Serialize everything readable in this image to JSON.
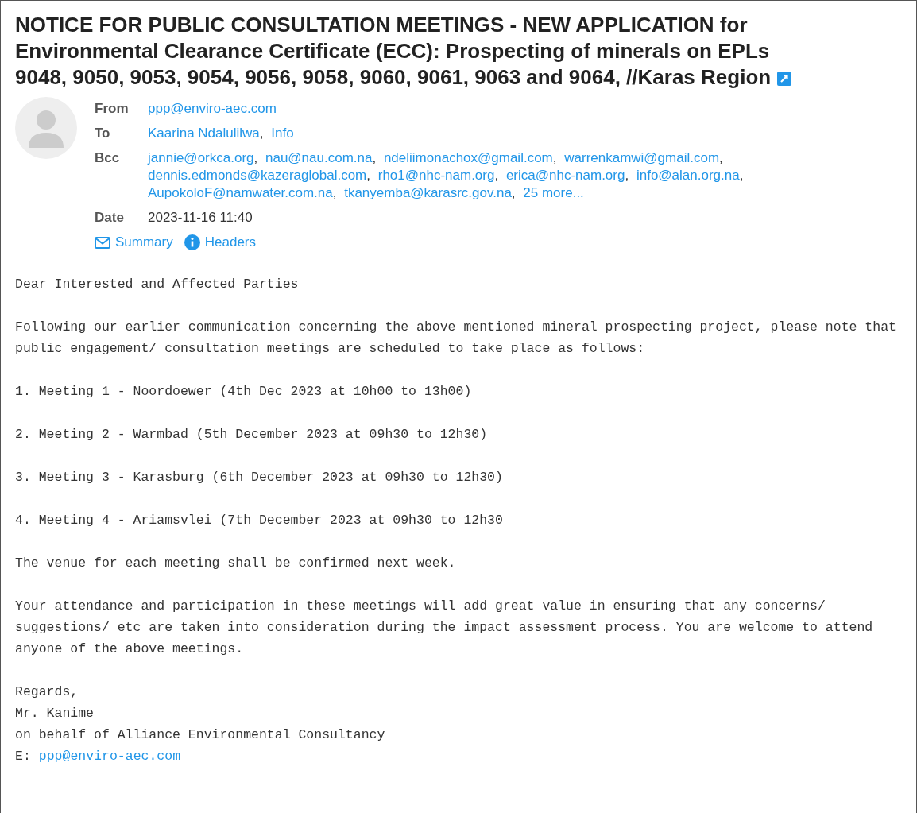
{
  "subject": {
    "text": "NOTICE FOR PUBLIC CONSULTATION MEETINGS - NEW APPLICATION for Environmental Clearance Certificate (ECC): Prospecting of minerals on EPLs 9048, 9050, 9053, 9054, 9056, 9058, 9060, 9061, 9063 and 9064, //Karas Region"
  },
  "header": {
    "separator": ",",
    "fields": [
      {
        "kind": "links",
        "label": "From",
        "values": [
          "ppp@enviro-aec.com"
        ]
      },
      {
        "kind": "links",
        "label": "To",
        "values": [
          "Kaarina Ndalulilwa",
          "Info"
        ]
      },
      {
        "kind": "links",
        "label": "Bcc",
        "values": [
          "jannie@orkca.org",
          "nau@nau.com.na",
          "ndeliimonachox@gmail.com",
          "warrenkamwi@gmail.com",
          "dennis.edmonds@kazeraglobal.com",
          "rho1@nhc-nam.org",
          "erica@nhc-nam.org",
          "info@alan.org.na",
          "AupokoloF@namwater.com.na",
          "tkanyemba@karasrc.gov.na",
          "25 more..."
        ]
      },
      {
        "kind": "text",
        "label": "Date",
        "values": [
          "2023-11-16 11:40"
        ]
      }
    ],
    "actions": [
      {
        "kind": "summary",
        "label": "Summary"
      },
      {
        "kind": "headers",
        "label": "Headers"
      }
    ]
  },
  "body": {
    "paragraphs": [
      "Dear Interested and Affected Parties",
      "Following our earlier communication concerning the above mentioned mineral prospecting project, please note that public engagement/ consultation meetings are scheduled to take place as follows:",
      "1. Meeting 1 - Noordoewer (4th Dec 2023 at 10h00 to 13h00)",
      "2. Meeting 2 - Warmbad (5th December 2023 at 09h30 to 12h30)",
      "3. Meeting 3 - Karasburg (6th December 2023 at 09h30 to 12h30)",
      "4. Meeting 4 - Ariamsvlei (7th December 2023 at 09h30 to 12h30",
      "The venue for each meeting shall be confirmed next week.",
      "Your attendance and participation in these meetings will add great value in ensuring that any concerns/ suggestions/ etc are taken into consideration during the impact assessment process. You are welcome to attend anyone of the above meetings."
    ],
    "signature": [
      "Regards,",
      "Mr. Kanime",
      "on behalf of Alliance Environmental Consultancy"
    ],
    "email": {
      "prefix": "E:",
      "address": "ppp@enviro-aec.com"
    }
  }
}
